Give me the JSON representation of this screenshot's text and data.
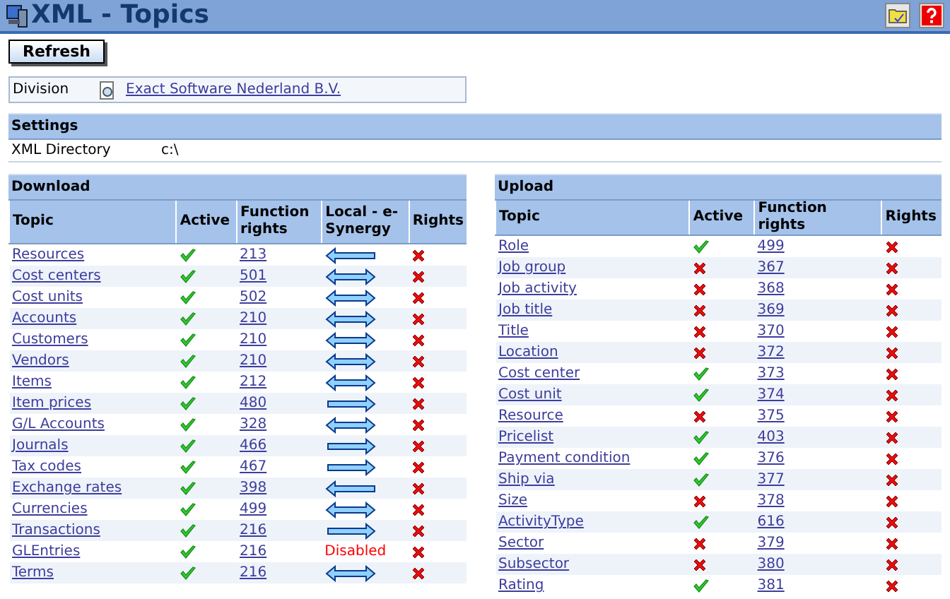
{
  "window": {
    "title": "XML - Topics"
  },
  "toolbar": {
    "refresh": "Refresh"
  },
  "division": {
    "label": "Division",
    "value": "Exact Software Nederland B.V."
  },
  "settings": {
    "title": "Settings",
    "rows": [
      {
        "label": "XML Directory",
        "value": "c:\\"
      }
    ]
  },
  "download": {
    "title": "Download",
    "columns": [
      "Topic",
      "Active",
      "Function rights",
      "Local - e-Synergy",
      "Rights"
    ],
    "rows": [
      {
        "topic": "Resources",
        "active": true,
        "function_rights": "213",
        "sync": {
          "kind": "left"
        },
        "rights": false
      },
      {
        "topic": "Cost centers",
        "active": true,
        "function_rights": "501",
        "sync": {
          "kind": "both"
        },
        "rights": false
      },
      {
        "topic": "Cost units",
        "active": true,
        "function_rights": "502",
        "sync": {
          "kind": "both"
        },
        "rights": false
      },
      {
        "topic": "Accounts",
        "active": true,
        "function_rights": "210",
        "sync": {
          "kind": "both"
        },
        "rights": false
      },
      {
        "topic": "Customers",
        "active": true,
        "function_rights": "210",
        "sync": {
          "kind": "both"
        },
        "rights": false
      },
      {
        "topic": "Vendors",
        "active": true,
        "function_rights": "210",
        "sync": {
          "kind": "both"
        },
        "rights": false
      },
      {
        "topic": "Items",
        "active": true,
        "function_rights": "212",
        "sync": {
          "kind": "both"
        },
        "rights": false
      },
      {
        "topic": "Item prices",
        "active": true,
        "function_rights": "480",
        "sync": {
          "kind": "right"
        },
        "rights": false
      },
      {
        "topic": "G/L Accounts",
        "active": true,
        "function_rights": "328",
        "sync": {
          "kind": "both"
        },
        "rights": false
      },
      {
        "topic": "Journals",
        "active": true,
        "function_rights": "466",
        "sync": {
          "kind": "right"
        },
        "rights": false
      },
      {
        "topic": "Tax codes",
        "active": true,
        "function_rights": "467",
        "sync": {
          "kind": "right"
        },
        "rights": false
      },
      {
        "topic": "Exchange rates",
        "active": true,
        "function_rights": "398",
        "sync": {
          "kind": "left"
        },
        "rights": false
      },
      {
        "topic": "Currencies",
        "active": true,
        "function_rights": "499",
        "sync": {
          "kind": "both"
        },
        "rights": false
      },
      {
        "topic": "Transactions",
        "active": true,
        "function_rights": "216",
        "sync": {
          "kind": "right"
        },
        "rights": false
      },
      {
        "topic": "GLEntries",
        "active": true,
        "function_rights": "216",
        "sync": {
          "kind": "text",
          "text": "Disabled"
        },
        "rights": false
      },
      {
        "topic": "Terms",
        "active": true,
        "function_rights": "216",
        "sync": {
          "kind": "both"
        },
        "rights": false
      }
    ]
  },
  "upload": {
    "title": "Upload",
    "columns": [
      "Topic",
      "Active",
      "Function rights",
      "Rights"
    ],
    "rows": [
      {
        "topic": "Role",
        "active": true,
        "function_rights": "499",
        "rights": false
      },
      {
        "topic": "Job group",
        "active": false,
        "function_rights": "367",
        "rights": false
      },
      {
        "topic": "Job activity",
        "active": false,
        "function_rights": "368",
        "rights": false
      },
      {
        "topic": "Job title",
        "active": false,
        "function_rights": "369",
        "rights": false
      },
      {
        "topic": "Title",
        "active": false,
        "function_rights": "370",
        "rights": false
      },
      {
        "topic": "Location",
        "active": false,
        "function_rights": "372",
        "rights": false
      },
      {
        "topic": "Cost center",
        "active": true,
        "function_rights": "373",
        "rights": false
      },
      {
        "topic": "Cost unit",
        "active": true,
        "function_rights": "374",
        "rights": false
      },
      {
        "topic": "Resource",
        "active": false,
        "function_rights": "375",
        "rights": false
      },
      {
        "topic": "Pricelist",
        "active": true,
        "function_rights": "403",
        "rights": false
      },
      {
        "topic": "Payment condition",
        "active": true,
        "function_rights": "376",
        "rights": false
      },
      {
        "topic": "Ship via",
        "active": true,
        "function_rights": "377",
        "rights": false
      },
      {
        "topic": "Size",
        "active": false,
        "function_rights": "378",
        "rights": false
      },
      {
        "topic": "ActivityType",
        "active": true,
        "function_rights": "616",
        "rights": false
      },
      {
        "topic": "Sector",
        "active": false,
        "function_rights": "379",
        "rights": false
      },
      {
        "topic": "Subsector",
        "active": false,
        "function_rights": "380",
        "rights": false
      },
      {
        "topic": "Rating",
        "active": true,
        "function_rights": "381",
        "rights": false
      }
    ]
  }
}
